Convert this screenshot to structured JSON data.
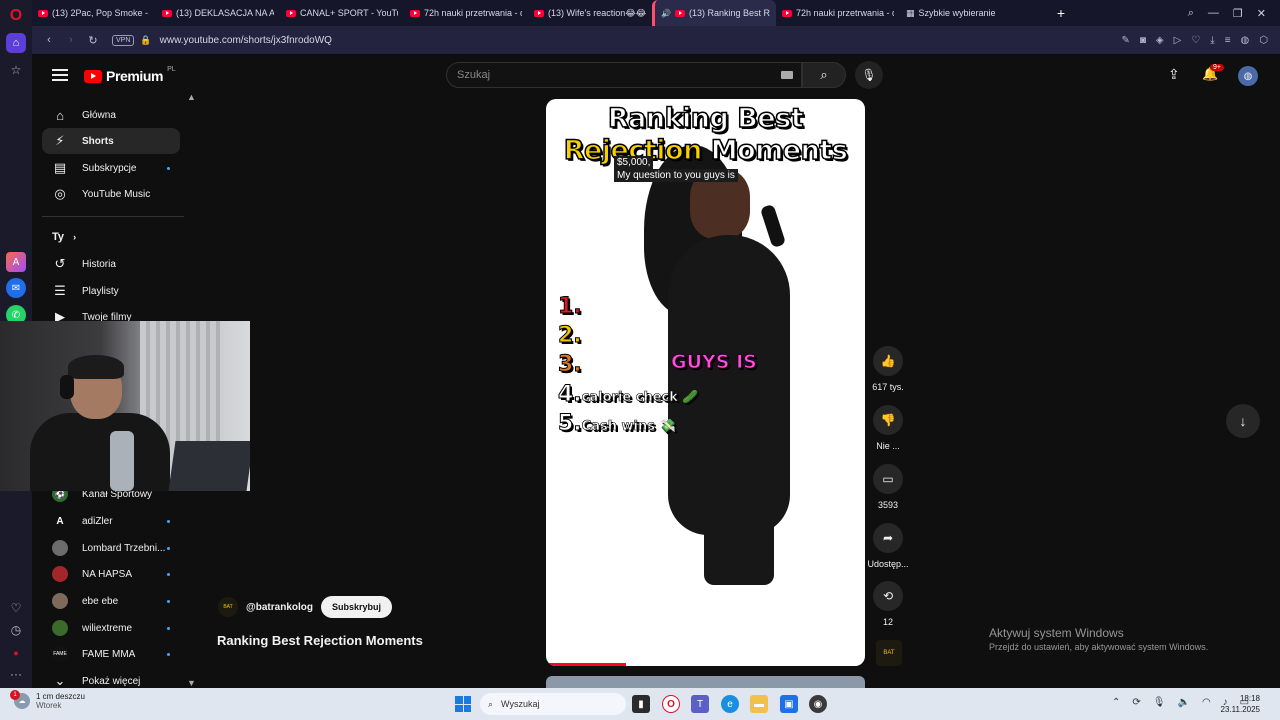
{
  "browser": {
    "tabs": [
      {
        "label": "(13) 2Pac, Pop Smoke - W",
        "active": false
      },
      {
        "label": "(13) DEKLASACJA NA ANF",
        "active": false
      },
      {
        "label": "CANAL+ SPORT - YouTub",
        "active": false
      },
      {
        "label": "72h nauki przetrwania - d",
        "active": false
      },
      {
        "label": "(13) Wife's reaction😂😂",
        "active": false
      },
      {
        "label": "(13) Ranking Best Reje",
        "active": true
      },
      {
        "label": "72h nauki przetrwania - d",
        "active": false
      },
      {
        "label": "Szybkie wybieranie",
        "active": false
      }
    ],
    "url": "www.youtube.com/shorts/jx3fnrodoWQ",
    "vpn_label": "VPN"
  },
  "youtube": {
    "brand": "Premium",
    "region": "PL",
    "search_placeholder": "Szukaj",
    "notification_count": "9+"
  },
  "sidebar": {
    "main_items": [
      {
        "label": "Główna",
        "icon": "home-icon"
      },
      {
        "label": "Shorts",
        "icon": "shorts-icon"
      },
      {
        "label": "Subskrypcje",
        "icon": "subscriptions-icon"
      },
      {
        "label": "YouTube Music",
        "icon": "music-icon"
      }
    ],
    "you_heading": "Ty",
    "you_items": [
      {
        "label": "Historia",
        "icon": "history-icon"
      },
      {
        "label": "Playlisty",
        "icon": "playlist-icon"
      },
      {
        "label": "Twoje filmy",
        "icon": "your-videos-icon"
      }
    ],
    "channels": [
      {
        "label": "Kanał Sportowy",
        "dot": false
      },
      {
        "label": "adiZler",
        "dot": true
      },
      {
        "label": "Lombard Trzebni...",
        "dot": true
      },
      {
        "label": "NA HAPSA",
        "dot": true
      },
      {
        "label": "ebe ebe",
        "dot": true
      },
      {
        "label": "wiliextreme",
        "dot": true
      },
      {
        "label": "FAME MMA",
        "dot": true
      }
    ],
    "show_more": "Pokaż więcej"
  },
  "short": {
    "title": "Ranking Best Rejection Moments",
    "overlay_title_line1": "Ranking Best",
    "overlay_title_line2_a": "Rejection",
    "overlay_title_line2_b": " Moments",
    "caption_1": "$5,000,",
    "caption_2": "My question to you guys is",
    "ranks": [
      {
        "num": "1.",
        "label": ""
      },
      {
        "num": "2.",
        "label": ""
      },
      {
        "num": "3.",
        "label": ""
      },
      {
        "num": "4.",
        "label": "calorie check 🥒"
      },
      {
        "num": "5.",
        "label": "Cash wins 💸"
      }
    ],
    "subtitle_overlay": "GUYS IS",
    "channel_handle": "@batrankolog",
    "subscribe_label": "Subskrybuj",
    "progress": 0.25
  },
  "actions": {
    "likes": "617 tys.",
    "dislike": "Nie ...",
    "comments": "3593",
    "share": "Udostęp...",
    "remix": "12"
  },
  "windows": {
    "activate_title": "Aktywuj system Windows",
    "activate_sub": "Przejdź do ustawień, aby aktywować system Windows.",
    "weather_line1": "1 cm deszczu",
    "weather_line2": "Wtorek",
    "weather_badge": "1",
    "taskbar_search": "Wyszukaj",
    "time": "18:18",
    "date": "23.11.2025"
  }
}
